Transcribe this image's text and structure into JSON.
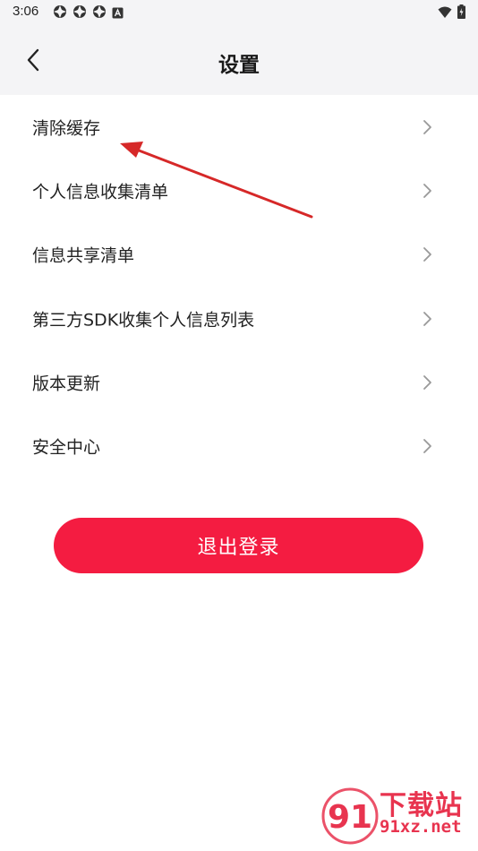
{
  "status_bar": {
    "time": "3:06",
    "left_icons": [
      "notification-icon",
      "notification-icon",
      "notification-icon",
      "a-icon"
    ],
    "right_icons": [
      "wifi-icon",
      "battery-icon"
    ]
  },
  "header": {
    "title": "设置"
  },
  "menu": {
    "items": [
      {
        "label": "清除缓存"
      },
      {
        "label": "个人信息收集清单"
      },
      {
        "label": "信息共享清单"
      },
      {
        "label": "第三方SDK收集个人信息列表"
      },
      {
        "label": "版本更新"
      },
      {
        "label": "安全中心"
      }
    ]
  },
  "logout": {
    "label": "退出登录"
  },
  "watermark": {
    "badge_text": "91",
    "title": "下载站",
    "url": "91xz.net"
  },
  "colors": {
    "accent": "#f41c41",
    "header_bg": "#f4f4f6",
    "annotation_arrow": "#d62828",
    "watermark": "#e8344f"
  }
}
